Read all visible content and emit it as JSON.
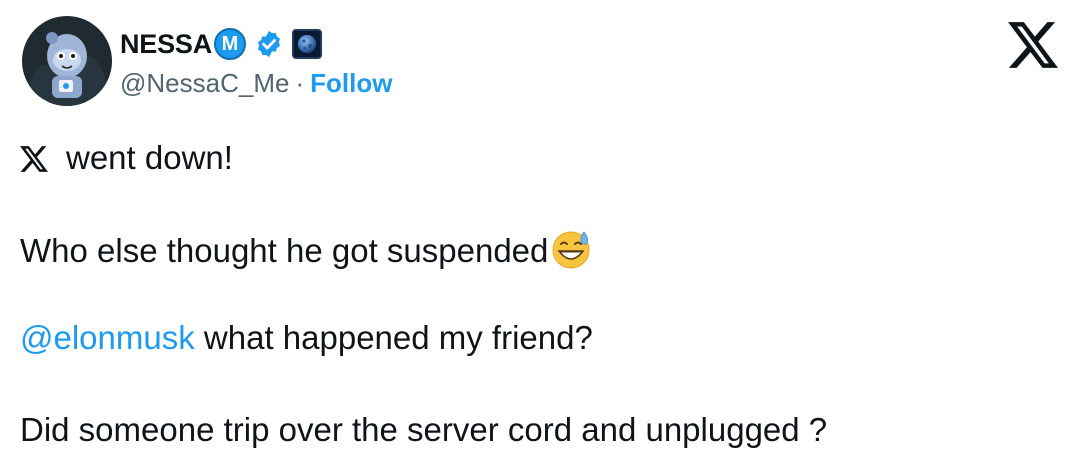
{
  "author": {
    "name": "NESSA",
    "badge_letter": "M",
    "handle": "@NessaC_Me",
    "separator": "·",
    "follow_label": "Follow"
  },
  "icons": {
    "avatar": "avatar-astronaut-icon",
    "m_badge": "m-badge-icon",
    "verified": "verified-badge-icon",
    "moon": "moon-icon",
    "x_logo": "x-logo-icon",
    "emoji": "grinning-sweat-emoji-icon"
  },
  "colors": {
    "text": "#0f1419",
    "secondary": "#536471",
    "accent": "#1d9bf0"
  },
  "tweet": {
    "line1_text": "went down!",
    "line2_text": "Who else thought he got suspended",
    "line3_mention": "@elonmusk",
    "line3_text": " what happened my friend?",
    "line4_text": "Did someone trip over the server cord and unplugged ?"
  }
}
